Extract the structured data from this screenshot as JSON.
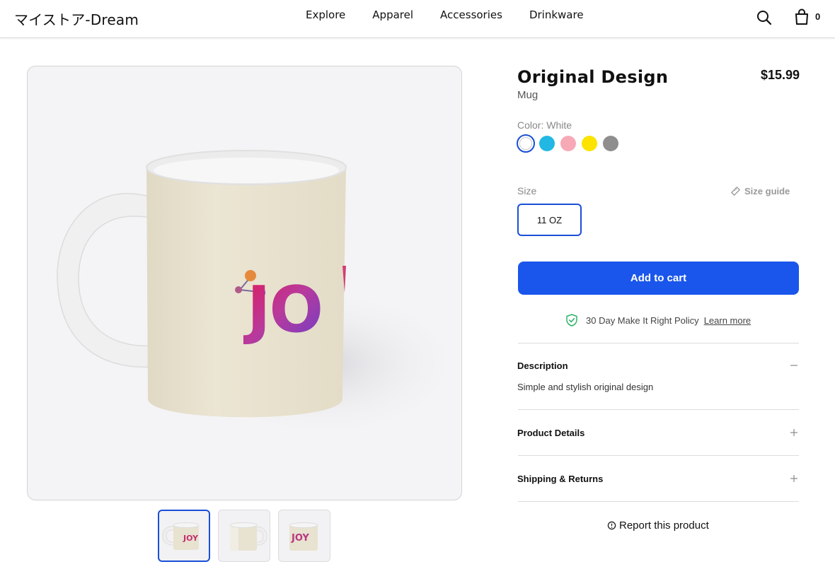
{
  "header": {
    "brand": "マイストア-Dream",
    "nav": [
      "Explore",
      "Apparel",
      "Accessories",
      "Drinkware"
    ],
    "cart_count": "0",
    "icons": {
      "search": "search-icon",
      "cart": "shopping-bag-icon"
    }
  },
  "gallery": {
    "main_image": "mug-front-joy",
    "thumbnails": [
      "mug-left-view",
      "mug-back-view",
      "mug-right-view"
    ],
    "selected_index": 0,
    "mug_print": "JOY"
  },
  "product": {
    "title": "Original Design",
    "type": "Mug",
    "price": "$15.99"
  },
  "color": {
    "label": "Color: White",
    "swatches": [
      "#ffffff",
      "#22b8e3",
      "#f7a9b6",
      "#fce300",
      "#8e8e8e"
    ],
    "selected_index": 0
  },
  "size": {
    "label": "Size",
    "guide_label": "Size guide",
    "options": [
      "11 OZ"
    ],
    "selected": "11 OZ"
  },
  "add_to_cart_label": "Add to cart",
  "policy": {
    "text": "30 Day Make It Right Policy",
    "link": "Learn more"
  },
  "accordion": {
    "description": {
      "title": "Description",
      "body": "Simple and stylish original design",
      "open": true
    },
    "details": {
      "title": "Product Details",
      "open": false
    },
    "shipping": {
      "title": "Shipping & Returns",
      "open": false
    }
  },
  "report_label": "Report this product",
  "colors": {
    "accent": "#1a56eb",
    "selected_border": "#1a4fd6",
    "shield": "#2fb36a"
  }
}
